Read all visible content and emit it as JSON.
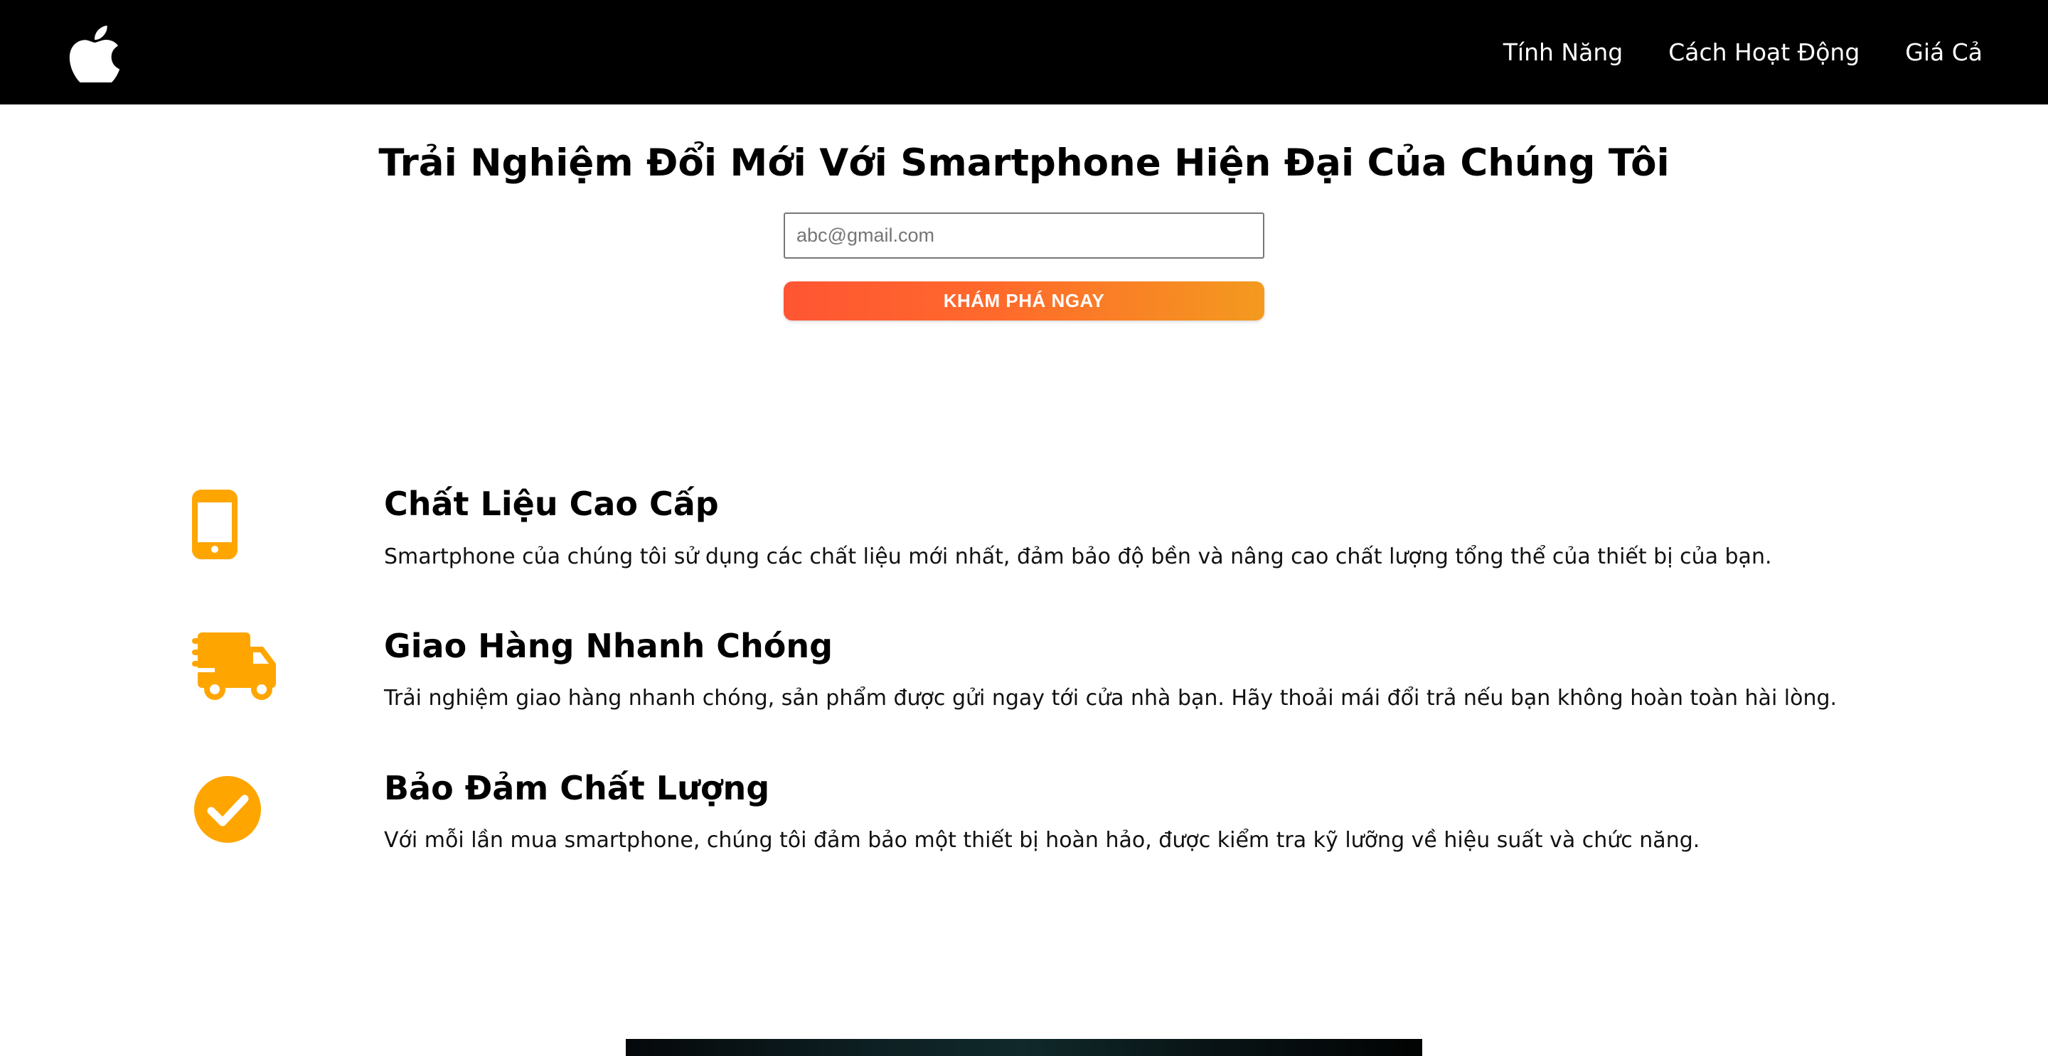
{
  "navbar": {
    "logo": "apple-logo",
    "links": [
      {
        "label": "Tính Năng"
      },
      {
        "label": "Cách Hoạt Động"
      },
      {
        "label": "Giá Cả"
      }
    ]
  },
  "hero": {
    "title": "Trải Nghiệm Đổi Mới Với Smartphone Hiện Đại Của Chúng Tôi",
    "email_placeholder": "abc@gmail.com",
    "email_value": "",
    "cta_label": "KHÁM PHÁ NGAY"
  },
  "features": [
    {
      "icon": "mobile-phone-icon",
      "title": "Chất Liệu Cao Cấp",
      "description": "Smartphone của chúng tôi sử dụng các chất liệu mới nhất, đảm bảo độ bền và nâng cao chất lượng tổng thể của thiết bị của bạn."
    },
    {
      "icon": "fast-delivery-truck-icon",
      "title": "Giao Hàng Nhanh Chóng",
      "description": "Trải nghiệm giao hàng nhanh chóng, sản phẩm được gửi ngay tới cửa nhà bạn. Hãy thoải mái đổi trả nếu bạn không hoàn toàn hài lòng."
    },
    {
      "icon": "check-circle-icon",
      "title": "Bảo Đảm Chất Lượng",
      "description": "Với mỗi lần mua smartphone, chúng tôi đảm bảo một thiết bị hoàn hảo, được kiểm tra kỹ lưỡng về hiệu suất và chức năng."
    }
  ],
  "colors": {
    "navbar_bg": "#000000",
    "accent_orange": "#FFA500",
    "cta_gradient_start": "#FF5533",
    "cta_gradient_end": "#F39A1F"
  }
}
